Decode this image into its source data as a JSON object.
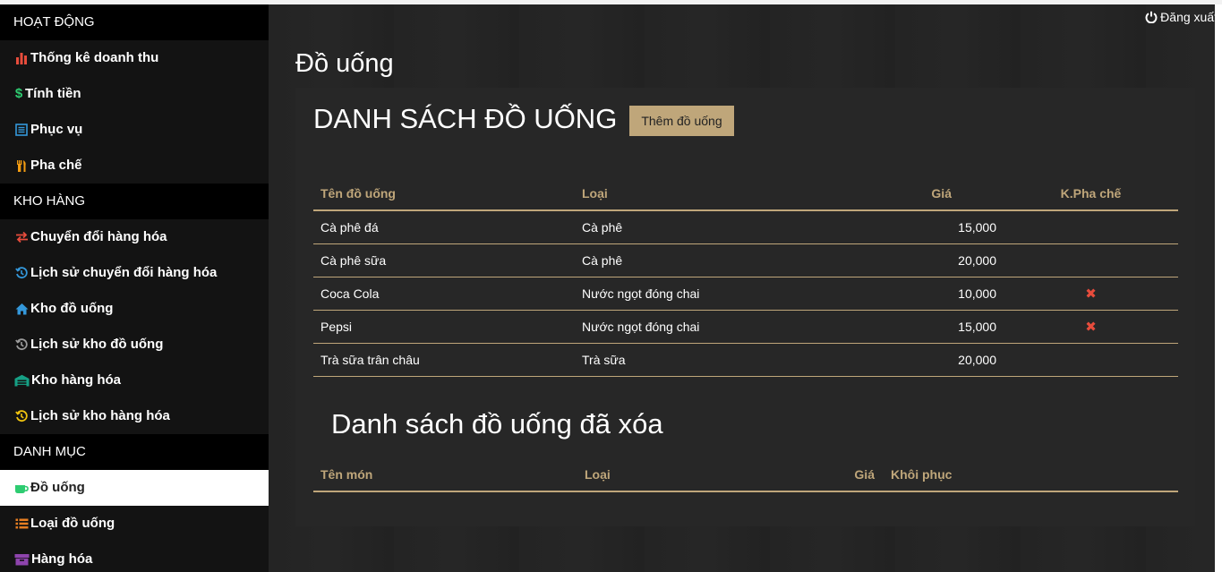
{
  "logout_label": "Đăng xuất",
  "sidebar": {
    "sections": [
      {
        "title": "HOẠT ĐỘNG",
        "items": [
          {
            "label": "Thống kê doanh thu",
            "icon": "bar-chart-icon",
            "color": "#e74c3c"
          },
          {
            "label": "Tính tiền",
            "icon": "dollar-icon",
            "color": "#2ecc71"
          },
          {
            "label": "Phục vụ",
            "icon": "list-icon",
            "color": "#3498db"
          },
          {
            "label": "Pha chế",
            "icon": "utensils-icon",
            "color": "#f39c12"
          }
        ]
      },
      {
        "title": "KHO HÀNG",
        "items": [
          {
            "label": "Chuyển đổi hàng hóa",
            "icon": "exchange-icon",
            "color": "#e74c3c"
          },
          {
            "label": "Lịch sử chuyển đổi hàng hóa",
            "icon": "history-icon",
            "color": "#3498db"
          },
          {
            "label": "Kho đồ uống",
            "icon": "home-icon",
            "color": "#3498db"
          },
          {
            "label": "Lịch sử kho đồ uống",
            "icon": "history-icon",
            "color": "#9b9b9b"
          },
          {
            "label": "Kho hàng hóa",
            "icon": "warehouse-icon",
            "color": "#16a085"
          },
          {
            "label": "Lịch sử kho hàng hóa",
            "icon": "history-icon",
            "color": "#f1c40f"
          }
        ]
      },
      {
        "title": "DANH MỤC",
        "items": [
          {
            "label": "Đồ uống",
            "icon": "coffee-cup-icon",
            "color": "#2ecc71",
            "active": true
          },
          {
            "label": "Loại đồ uống",
            "icon": "list-icon",
            "color": "#e67e22"
          },
          {
            "label": "Hàng hóa",
            "icon": "box-icon",
            "color": "#8e44ad"
          }
        ]
      }
    ]
  },
  "page_title": "Đồ uống",
  "list_title": "DANH SÁCH ĐỒ UỐNG",
  "add_button_label": "Thêm đồ uống",
  "table": {
    "headers": [
      "Tên đồ uống",
      "Loại",
      "Giá",
      "K.Pha chế"
    ],
    "rows": [
      {
        "name": "Cà phê đá",
        "type": "Cà phê",
        "price": "15,000",
        "delete": false
      },
      {
        "name": "Cà phê sữa",
        "type": "Cà phê",
        "price": "20,000",
        "delete": false
      },
      {
        "name": "Coca Cola",
        "type": "Nước ngọt đóng chai",
        "price": "10,000",
        "delete": true
      },
      {
        "name": "Pepsi",
        "type": "Nước ngọt đóng chai",
        "price": "15,000",
        "delete": true
      },
      {
        "name": "Trà sữa trân châu",
        "type": "Trà sữa",
        "price": "20,000",
        "delete": false
      }
    ]
  },
  "deleted_title": "Danh sách đồ uống đã xóa",
  "deleted_table": {
    "headers": [
      "Tên món",
      "Loại",
      "Giá",
      "Khôi phục"
    ]
  },
  "delete_mark": "✖",
  "colors": {
    "accent": "#bfa67a",
    "danger": "#e74c3c"
  }
}
